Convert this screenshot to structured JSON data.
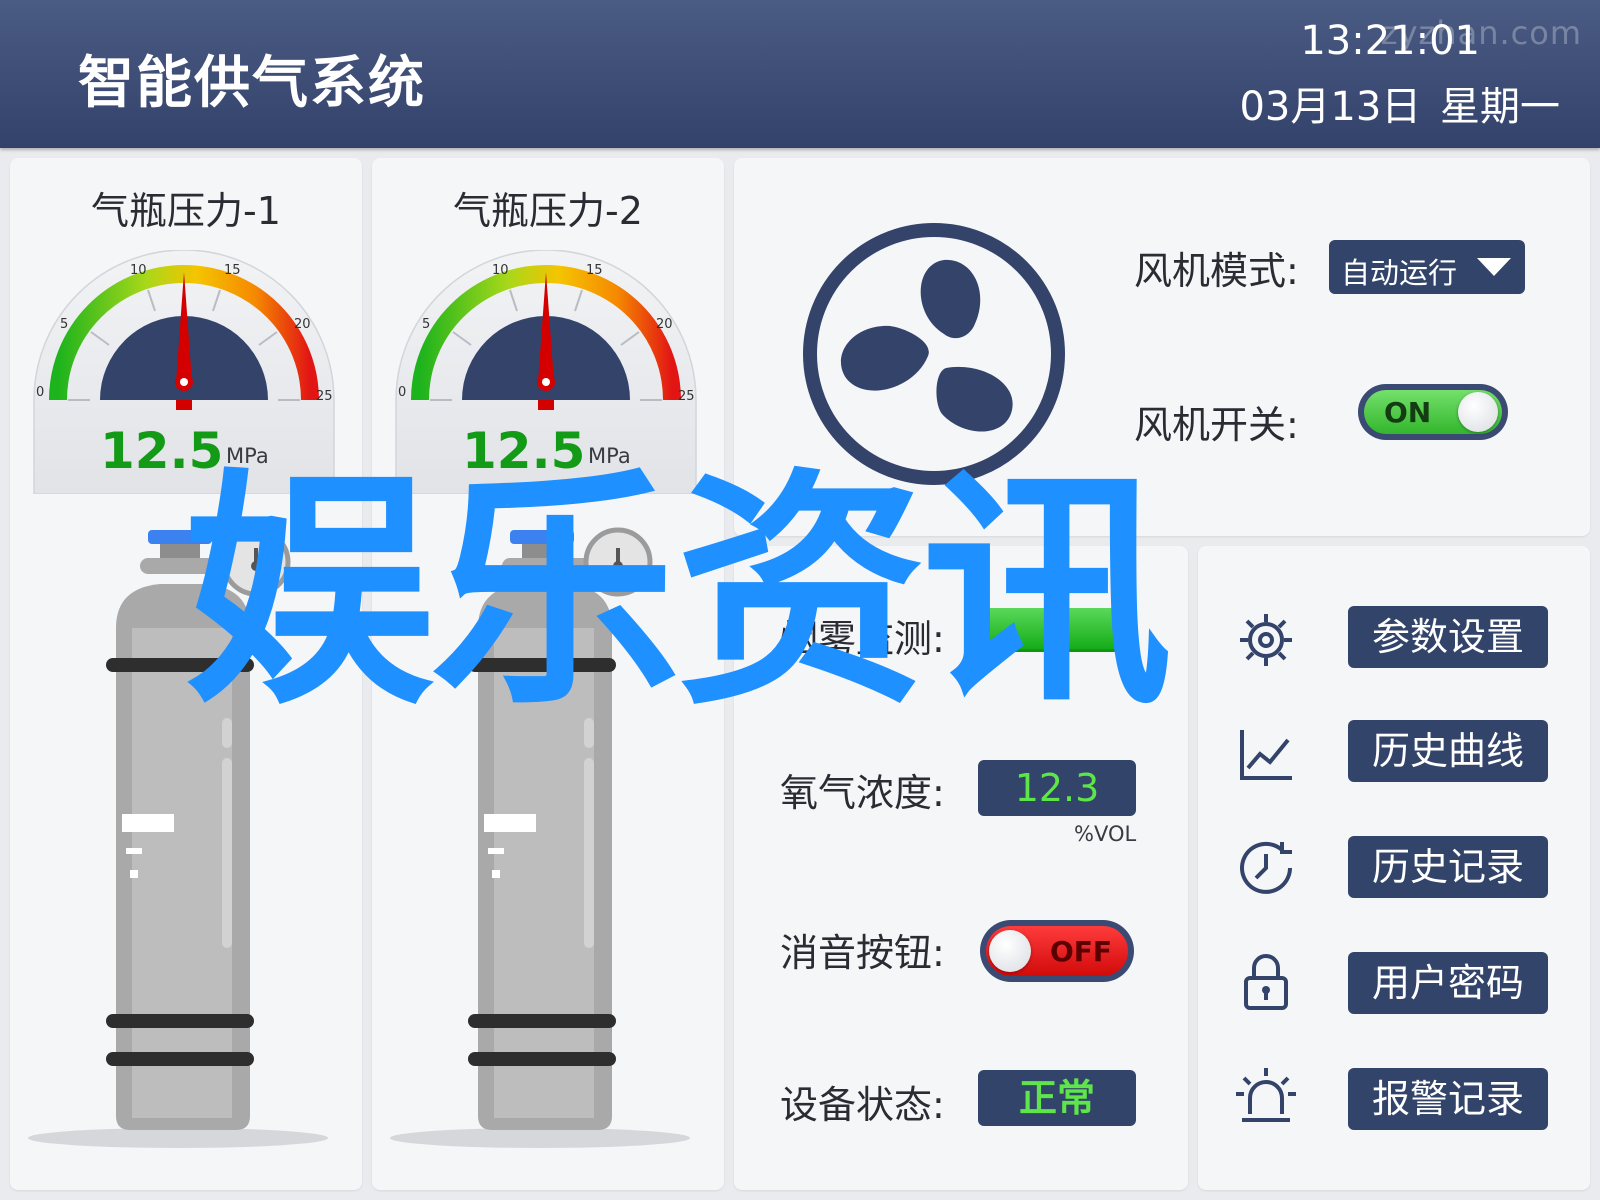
{
  "header": {
    "title": "智能供气系统",
    "time": "13:21:01",
    "date": "03月13日 星期一",
    "watermark": "zyzhan.com"
  },
  "gauges": [
    {
      "title": "气瓶压力-1",
      "value": "12.5",
      "unit": "MPa",
      "needle_value": 12.5,
      "ticks": [
        "0",
        "5",
        "10",
        "15",
        "20",
        "25"
      ]
    },
    {
      "title": "气瓶压力-2",
      "value": "12.5",
      "unit": "MPa",
      "needle_value": 12.5,
      "ticks": [
        "0",
        "5",
        "10",
        "15",
        "20",
        "25"
      ]
    }
  ],
  "fan": {
    "icon": "fan-icon",
    "mode_label": "风机模式:",
    "mode_value": "自动运行",
    "switch_label": "风机开关:",
    "switch_state": "ON"
  },
  "sensors": {
    "smoke_label": "烟雾监测:",
    "oxygen_label": "氧气浓度:",
    "oxygen_value": "12.3",
    "oxygen_unit": "%VOL",
    "mute_label": "消音按钮:",
    "mute_state": "OFF",
    "status_label": "设备状态:",
    "status_value": "正常"
  },
  "menu": [
    {
      "icon": "gear-icon",
      "label": "参数设置"
    },
    {
      "icon": "chart-icon",
      "label": "历史曲线"
    },
    {
      "icon": "clock-icon",
      "label": "历史记录"
    },
    {
      "icon": "lock-icon",
      "label": "用户密码"
    },
    {
      "icon": "alarm-icon",
      "label": "报警记录"
    }
  ],
  "overlay": {
    "text": "娱乐资讯"
  },
  "colors": {
    "header": "#3d4d76",
    "button": "#33446b",
    "value_green": "#139a17",
    "on_green": "#33b62d",
    "off_red": "#e01515",
    "overlay_blue": "#1e90ff"
  }
}
